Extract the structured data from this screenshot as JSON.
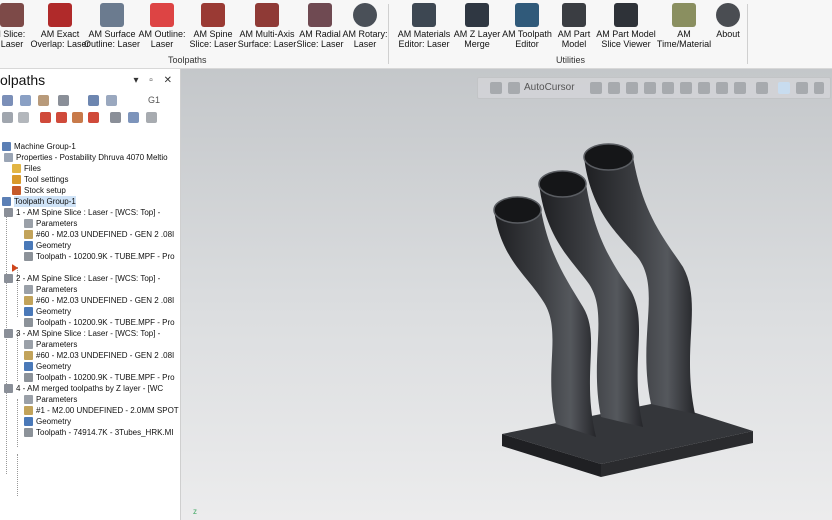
{
  "ribbon": {
    "toolpaths_group": "Toolpaths",
    "utilities_group": "Utilities",
    "buttons": [
      {
        "label": "l Slice:\nLaser",
        "icon": "slice-icon"
      },
      {
        "label": "AM Exact\nOverlap: Laser",
        "icon": "exact-overlap-icon"
      },
      {
        "label": "AM Surface\nOutline: Laser",
        "icon": "surface-outline-icon"
      },
      {
        "label": "AM Outline:\nLaser",
        "icon": "outline-icon"
      },
      {
        "label": "AM Spine\nSlice: Laser",
        "icon": "spine-slice-icon"
      },
      {
        "label": "AM Multi-Axis\nSurface: Laser",
        "icon": "multi-axis-icon"
      },
      {
        "label": "AM Radial\nSlice: Laser",
        "icon": "radial-slice-icon"
      },
      {
        "label": "AM Rotary:\nLaser",
        "icon": "rotary-icon"
      },
      {
        "label": "AM Materials\nEditor: Laser",
        "icon": "materials-editor-icon"
      },
      {
        "label": "AM Z Layer\nMerge",
        "icon": "z-layer-merge-icon"
      },
      {
        "label": "AM Toolpath\nEditor",
        "icon": "toolpath-editor-icon"
      },
      {
        "label": "AM Part\nModel",
        "icon": "part-model-icon"
      },
      {
        "label": "AM Part Model\nSlice Viewer",
        "icon": "slice-viewer-icon"
      },
      {
        "label": "AM\nTime/Material",
        "icon": "time-material-icon"
      },
      {
        "label": "About",
        "icon": "about-icon"
      }
    ]
  },
  "panel": {
    "title": "olpaths",
    "controls": "▾ ▫ ✕",
    "toolbar_second_label": "G1"
  },
  "tree": [
    {
      "text": "Machine Group-1",
      "icon": "machine-group-icon"
    },
    {
      "text": "Properties - Postability Dhruva 4070 Meltio",
      "icon": "properties-icon"
    },
    {
      "text": "Files",
      "icon": "folder-icon"
    },
    {
      "text": "Tool settings",
      "icon": "tool-settings-icon"
    },
    {
      "text": "Stock setup",
      "icon": "stock-setup-icon"
    },
    {
      "text": "Toolpath Group-1",
      "icon": "toolpath-group-icon"
    },
    {
      "text": "1 - AM Spine Slice : Laser - [WCS: Top] -",
      "icon": "operation-icon"
    },
    {
      "text": "Parameters",
      "icon": "parameters-icon"
    },
    {
      "text": "#60 - M2.03 UNDEFINED - GEN 2 .08I",
      "icon": "tool-icon"
    },
    {
      "text": "Geometry",
      "icon": "geometry-icon"
    },
    {
      "text": "Toolpath - 10200.9K - TUBE.MPF - Pro",
      "icon": "toolpath-file-icon"
    },
    {
      "text": "",
      "icon": "insert-arrow-icon"
    },
    {
      "text": "2 - AM Spine Slice : Laser - [WCS: Top] -",
      "icon": "operation-icon"
    },
    {
      "text": "Parameters",
      "icon": "parameters-icon"
    },
    {
      "text": "#60 - M2.03 UNDEFINED - GEN 2 .08I",
      "icon": "tool-icon"
    },
    {
      "text": "Geometry",
      "icon": "geometry-icon"
    },
    {
      "text": "Toolpath - 10200.9K - TUBE.MPF - Pro",
      "icon": "toolpath-file-icon"
    },
    {
      "text": "3 - AM Spine Slice : Laser - [WCS: Top] -",
      "icon": "operation-icon"
    },
    {
      "text": "Parameters",
      "icon": "parameters-icon"
    },
    {
      "text": "#60 - M2.03 UNDEFINED - GEN 2 .08I",
      "icon": "tool-icon"
    },
    {
      "text": "Geometry",
      "icon": "geometry-icon"
    },
    {
      "text": "Toolpath - 10200.9K - TUBE.MPF - Pro",
      "icon": "toolpath-file-icon"
    },
    {
      "text": "4 - AM merged toolpaths by Z layer - [WC",
      "icon": "operation-icon"
    },
    {
      "text": "Parameters",
      "icon": "parameters-icon"
    },
    {
      "text": "#1 - M2.00 UNDEFINED - 2.0MM SPOT",
      "icon": "tool-icon"
    },
    {
      "text": "Geometry",
      "icon": "geometry-icon"
    },
    {
      "text": "Toolpath - 74914.7K - 3Tubes_HRK.MI",
      "icon": "toolpath-file-icon"
    }
  ],
  "viewport": {
    "autocursor": "AutoCursor",
    "axis_label": "z"
  },
  "colors": {
    "ribbon_bg": "#f7f7f7",
    "selection": "#cfe3f7",
    "model": "#2d2e31",
    "viewport_top": "#c4c7ca"
  }
}
